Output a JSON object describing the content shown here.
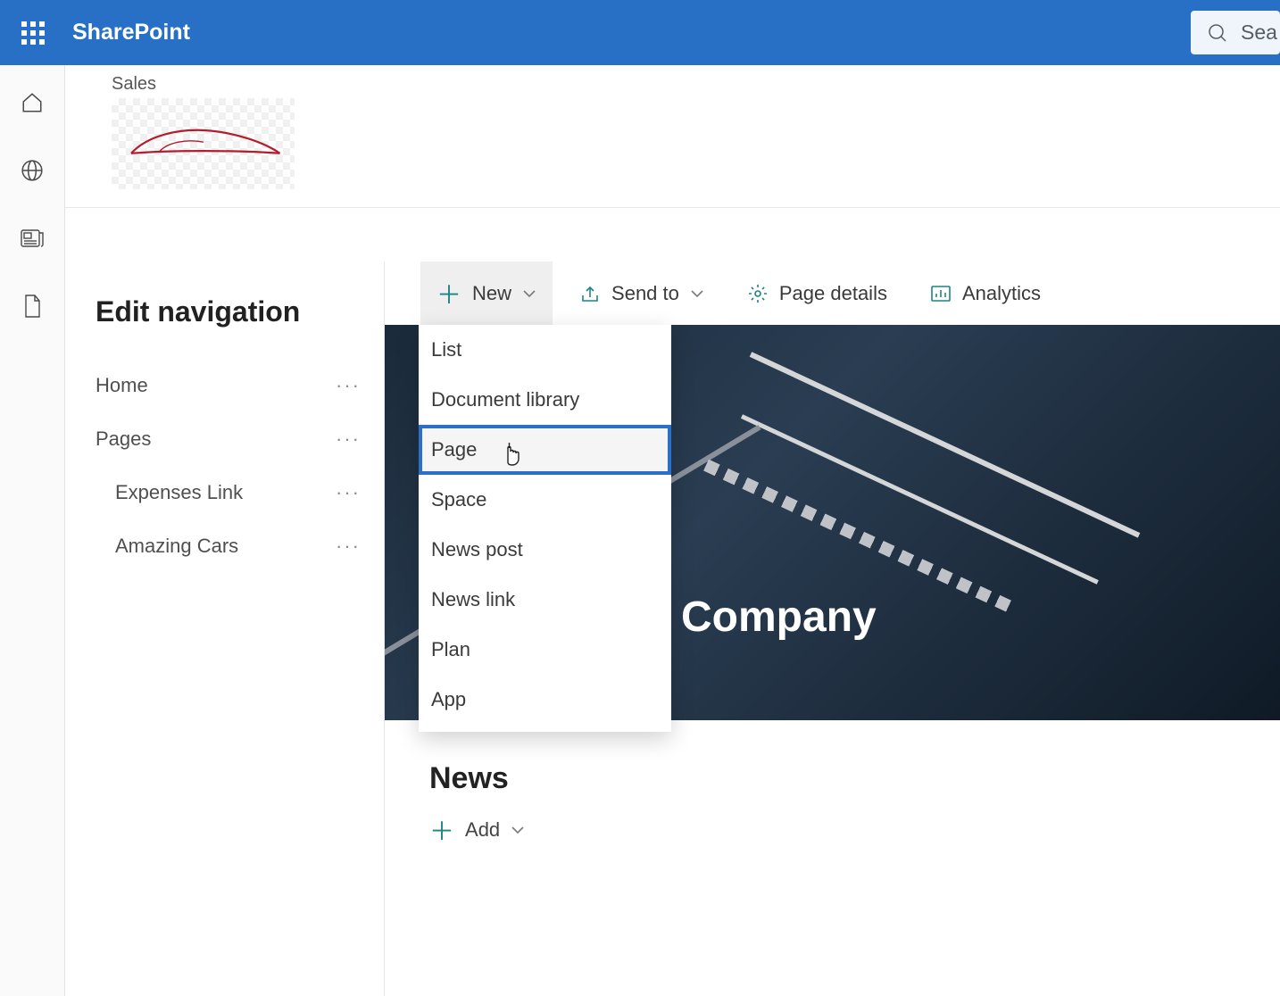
{
  "header": {
    "brand": "SharePoint",
    "search_placeholder": "Sea"
  },
  "site": {
    "name": "Sales"
  },
  "nav": {
    "title": "Edit navigation",
    "items": [
      {
        "label": "Home",
        "child": false
      },
      {
        "label": "Pages",
        "child": false
      },
      {
        "label": "Expenses Link",
        "child": true
      },
      {
        "label": "Amazing Cars",
        "child": true
      }
    ]
  },
  "toolbar": {
    "new_label": "New",
    "sendto_label": "Send to",
    "pagedetails_label": "Page details",
    "analytics_label": "Analytics"
  },
  "dropdown": {
    "items": [
      {
        "label": "List",
        "hl": false
      },
      {
        "label": "Document library",
        "hl": false
      },
      {
        "label": "Page",
        "hl": true
      },
      {
        "label": "Space",
        "hl": false
      },
      {
        "label": "News post",
        "hl": false
      },
      {
        "label": "News link",
        "hl": false
      },
      {
        "label": "Plan",
        "hl": false
      },
      {
        "label": "App",
        "hl": false
      }
    ]
  },
  "hero": {
    "title_fragment": "r Company"
  },
  "news": {
    "title": "News",
    "add_label": "Add"
  }
}
